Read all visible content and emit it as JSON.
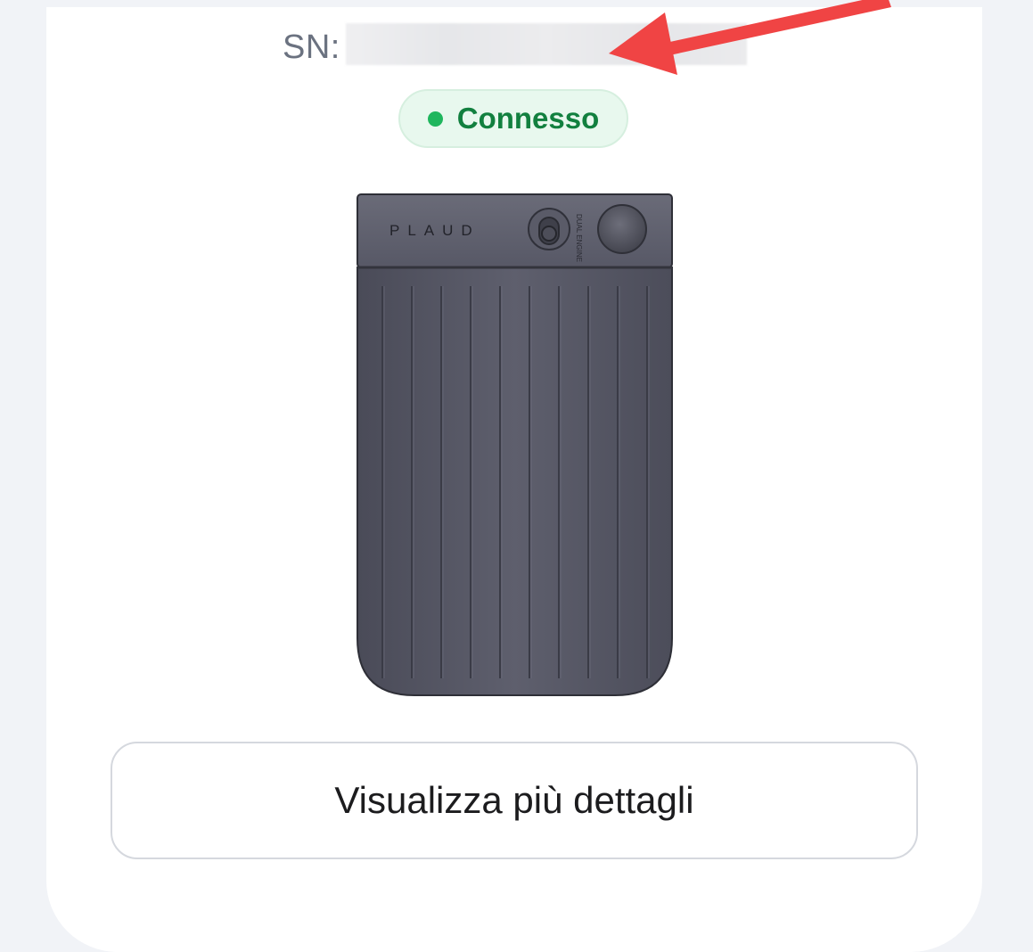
{
  "device_card": {
    "sn_label": "SN:",
    "status": {
      "text": "Connesso",
      "dot_color": "#1fb65d",
      "text_color": "#12803f"
    },
    "device_image": {
      "brand": "PLAUD",
      "engine_label": "DUAL ENGINE"
    },
    "details_button": {
      "label": "Visualizza più dettagli"
    }
  },
  "annotation": {
    "arrow_color": "#f04444"
  }
}
